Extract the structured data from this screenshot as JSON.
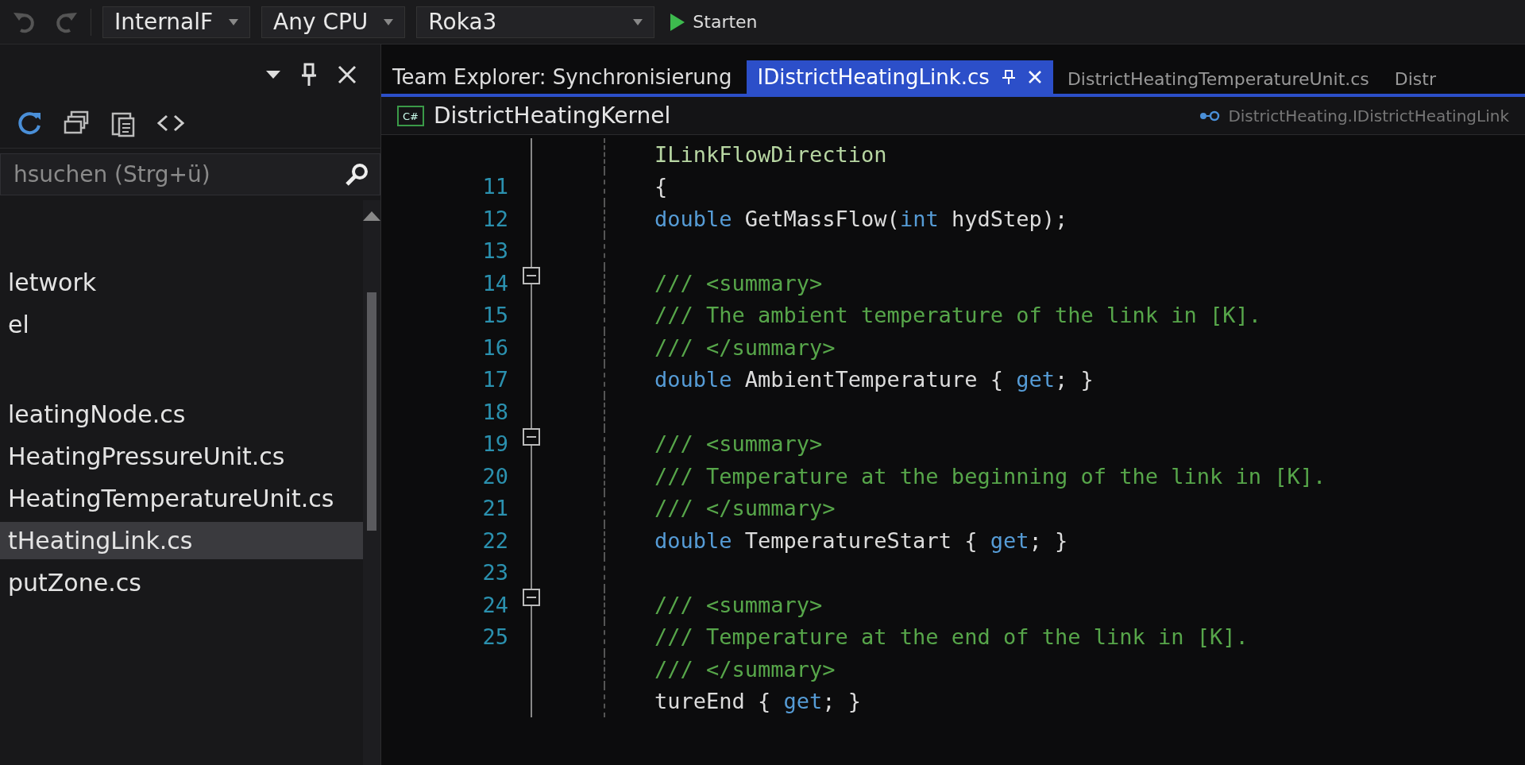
{
  "toolbar": {
    "dropdowns": [
      {
        "label": "InternalF"
      },
      {
        "label": "Any CPU"
      },
      {
        "label": "Roka3"
      }
    ],
    "start_button": {
      "label": "Starten"
    }
  },
  "side_panel": {
    "search": {
      "placeholder": "hsuchen (Strg+ü)"
    },
    "items": [
      {
        "label": "letwork",
        "selected": false
      },
      {
        "label": "el",
        "selected": false
      },
      {
        "label": "leatingNode.cs",
        "selected": false
      },
      {
        "label": "HeatingPressureUnit.cs",
        "selected": false
      },
      {
        "label": "HeatingTemperatureUnit.cs",
        "selected": false
      },
      {
        "label": "tHeatingLink.cs",
        "selected": true
      },
      {
        "label": "putZone.cs",
        "selected": false
      }
    ]
  },
  "tabs": [
    {
      "label": "Team Explorer: Synchronisierung",
      "selected": false
    },
    {
      "label": "IDistrictHeatingLink.cs",
      "selected": true
    },
    {
      "label": "DistrictHeatingTemperatureUnit.cs",
      "selected": false
    },
    {
      "label": "Distr",
      "selected": false
    }
  ],
  "nav_bar": {
    "project_badge": "C#",
    "project": "DistrictHeatingKernel",
    "member": "DistrictHeating.IDistrictHeatingLink"
  },
  "editor": {
    "lines": [
      {
        "code": [
          {
            "kind": "type",
            "text": "ILinkFlowDirection"
          }
        ]
      },
      {
        "number": "11",
        "code": [
          {
            "kind": "plain",
            "text": "{"
          }
        ]
      },
      {
        "number": "12",
        "code": [
          {
            "kind": "keyword",
            "text": "double"
          },
          {
            "kind": "plain",
            "text": " GetMassFlow("
          },
          {
            "kind": "keyword",
            "text": "int"
          },
          {
            "kind": "plain",
            "text": " hydStep);"
          }
        ]
      },
      {
        "number": "13"
      },
      {
        "number": "14",
        "fold_expanded": true,
        "code": [
          {
            "kind": "comment",
            "text": "/// <summary>"
          }
        ]
      },
      {
        "number": "15",
        "code": [
          {
            "kind": "comment",
            "text": "/// The ambient temperature of the link in [K]."
          }
        ]
      },
      {
        "number": "16",
        "code": [
          {
            "kind": "comment",
            "text": "/// </summary>"
          }
        ]
      },
      {
        "number": "17",
        "code": [
          {
            "kind": "keyword",
            "text": "double"
          },
          {
            "kind": "plain",
            "text": " AmbientTemperature { "
          },
          {
            "kind": "keyword",
            "text": "get"
          },
          {
            "kind": "plain",
            "text": "; }"
          }
        ]
      },
      {
        "number": "18"
      },
      {
        "number": "19",
        "fold_expanded": true,
        "code": [
          {
            "kind": "comment",
            "text": "/// <summary>"
          }
        ]
      },
      {
        "number": "20",
        "code": [
          {
            "kind": "comment",
            "text": "/// Temperature at the beginning of the link in [K]."
          }
        ]
      },
      {
        "number": "21",
        "code": [
          {
            "kind": "comment",
            "text": "/// </summary>"
          }
        ]
      },
      {
        "number": "22",
        "code": [
          {
            "kind": "keyword",
            "text": "double"
          },
          {
            "kind": "plain",
            "text": " TemperatureStart { "
          },
          {
            "kind": "keyword",
            "text": "get"
          },
          {
            "kind": "plain",
            "text": "; }"
          }
        ]
      },
      {
        "number": "23"
      },
      {
        "number": "24",
        "fold_expanded": true,
        "code": [
          {
            "kind": "comment",
            "text": "/// <summary>"
          }
        ]
      },
      {
        "number": "25",
        "code": [
          {
            "kind": "comment",
            "text": "/// Temperature at the end of the link in [K]."
          }
        ]
      },
      {
        "code": [
          {
            "kind": "comment",
            "text": "/// </summary>"
          }
        ]
      },
      {
        "code": [
          {
            "kind": "plain",
            "text": "tureEnd { "
          },
          {
            "kind": "keyword",
            "text": "get"
          },
          {
            "kind": "plain",
            "text": "; }"
          }
        ]
      }
    ]
  }
}
